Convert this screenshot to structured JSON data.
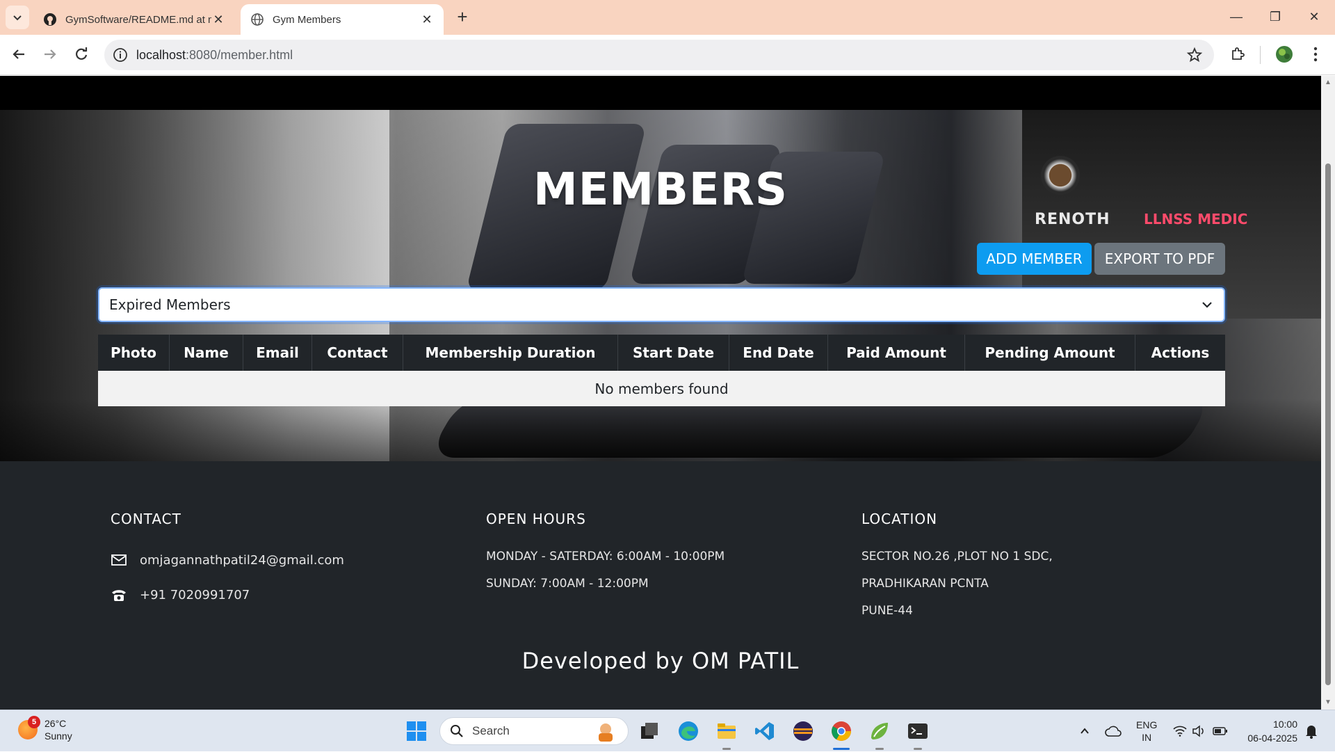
{
  "browser": {
    "tabs": [
      {
        "title": "GymSoftware/README.md at m",
        "active": false
      },
      {
        "title": "Gym Members",
        "active": true
      }
    ],
    "url_host": "localhost",
    "url_path": ":8080/member.html",
    "window_controls": {
      "minimize": "—",
      "restore": "❐",
      "close": "✕"
    },
    "new_tab": "+"
  },
  "page": {
    "title": "MEMBERS",
    "add_button": "ADD MEMBER",
    "export_button": "EXPORT TO PDF",
    "filter_selected": "Expired Members",
    "table": {
      "columns": [
        "Photo",
        "Name",
        "Email",
        "Contact",
        "Membership Duration",
        "Start Date",
        "End Date",
        "Paid Amount",
        "Pending Amount",
        "Actions"
      ],
      "empty_message": "No members found"
    },
    "hero_sign": "RENOTH",
    "hero_sign2": "LLNSS MEDIC"
  },
  "footer": {
    "contact": {
      "heading": "CONTACT",
      "email": "omjagannathpatil24@gmail.com",
      "phone": "+91 7020991707"
    },
    "hours": {
      "heading": "OPEN HOURS",
      "lines": [
        "MONDAY - SATERDAY: 6:00AM - 10:00PM",
        "SUNDAY: 7:00AM - 12:00PM"
      ]
    },
    "location": {
      "heading": "LOCATION",
      "lines": [
        "SECTOR NO.26 ,PLOT NO 1 SDC,",
        "PRADHIKARAN PCNTA",
        "PUNE-44"
      ]
    },
    "developed_by": "Developed by OM PATIL"
  },
  "taskbar": {
    "weather_temp": "26°C",
    "weather_desc": "Sunny",
    "weather_badge": "5",
    "search_label": "Search",
    "lang_top": "ENG",
    "lang_bottom": "IN",
    "time": "10:00",
    "date": "06-04-2025",
    "icons": [
      "windows-start-icon",
      "task-view-icon",
      "edge-icon",
      "file-explorer-icon",
      "vscode-icon",
      "eclipse-icon",
      "chrome-icon",
      "springtool-icon",
      "terminal-icon"
    ]
  },
  "colors": {
    "add_button": "#0d9cf0",
    "export_button": "#6c757d",
    "table_header": "#212529",
    "footer_bg": "#212529",
    "tabbar_bg": "#f9d4c0"
  }
}
